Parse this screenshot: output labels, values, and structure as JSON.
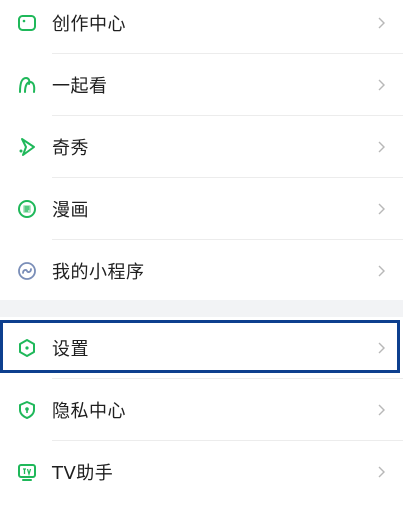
{
  "menu_group_1": {
    "items": [
      {
        "label": "创作中心",
        "icon": "creator-icon"
      },
      {
        "label": "一起看",
        "icon": "watch-together-icon"
      },
      {
        "label": "奇秀",
        "icon": "qixiu-icon"
      },
      {
        "label": "漫画",
        "icon": "comic-icon"
      },
      {
        "label": "我的小程序",
        "icon": "mini-program-icon"
      }
    ]
  },
  "menu_group_2": {
    "items": [
      {
        "label": "设置",
        "icon": "settings-icon",
        "highlighted": true
      },
      {
        "label": "隐私中心",
        "icon": "privacy-shield-icon"
      },
      {
        "label": "TV助手",
        "icon": "tv-icon"
      }
    ]
  },
  "colors": {
    "accent": "#1fb85a",
    "highlight_border": "#0d3f8e",
    "text": "#1f1f1f",
    "chevron": "#b8b8b8",
    "background": "#f2f3f5"
  }
}
